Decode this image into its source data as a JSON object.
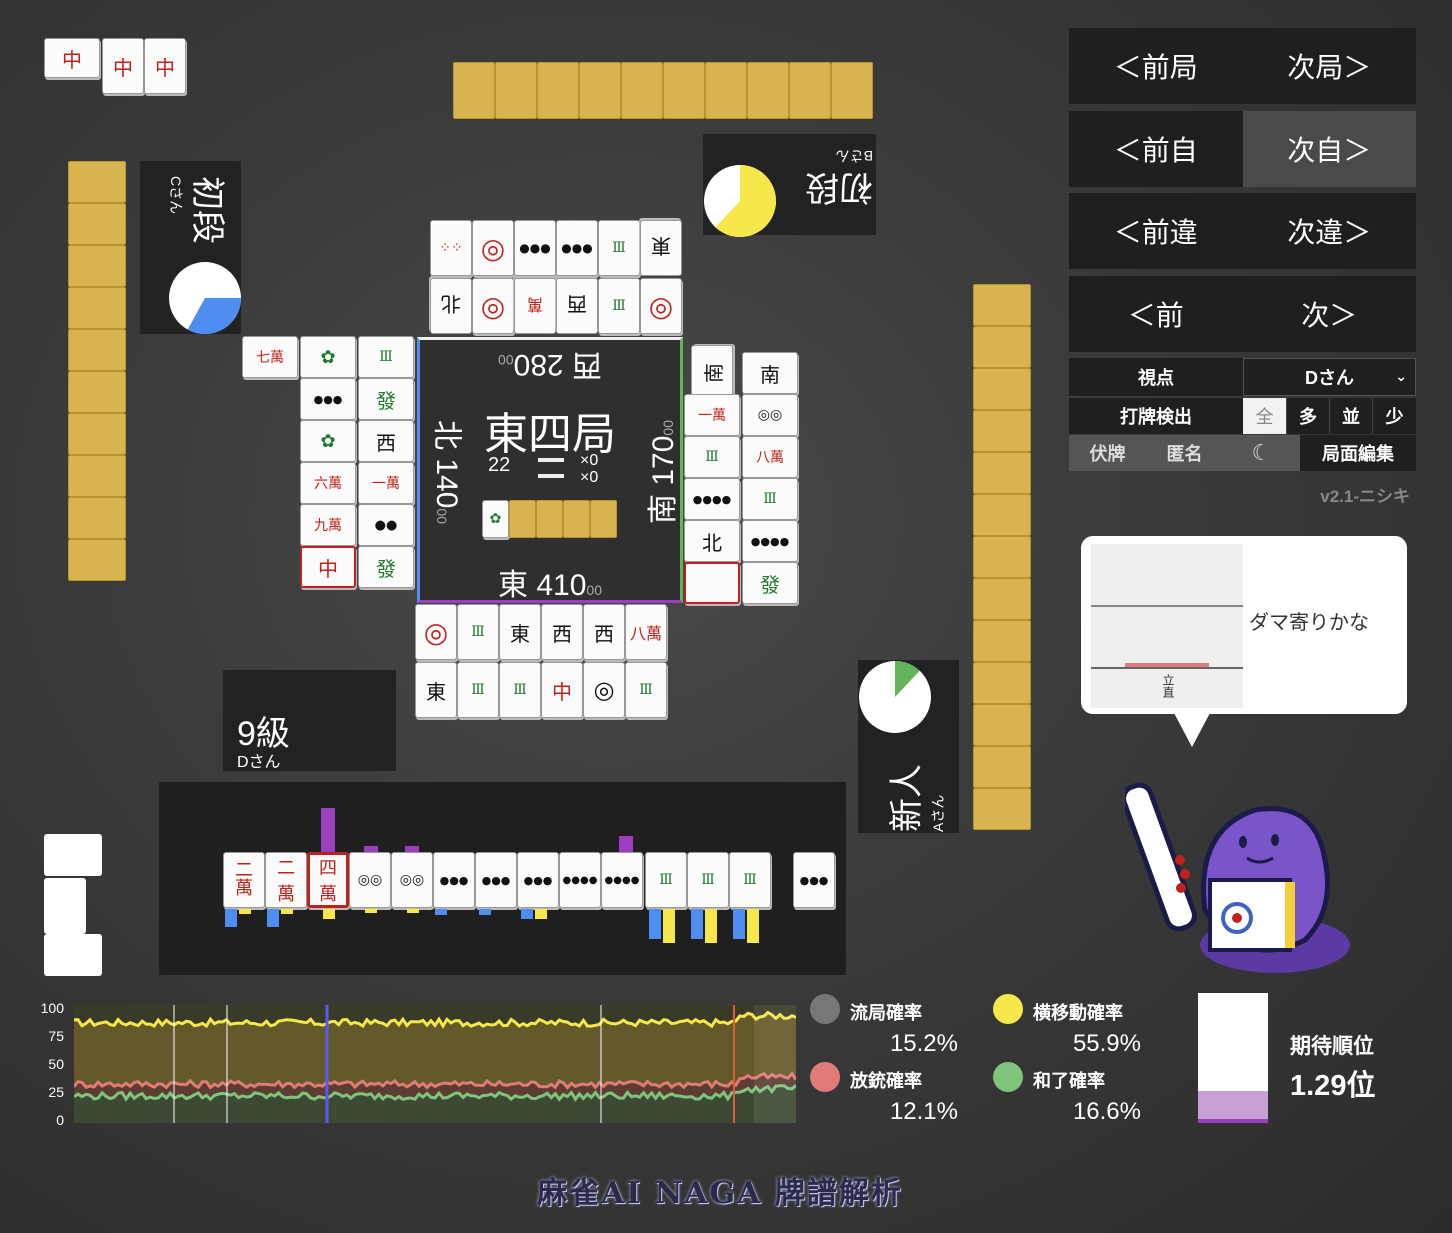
{
  "round": {
    "title": "東四局",
    "honba": "22",
    "riichi_sticks": "0",
    "honba_sticks": "0",
    "score_east": "東 410",
    "score_east_sub": "00",
    "score_south": "南 170",
    "score_south_sub": "00",
    "score_west": "西 280",
    "score_west_sub": "00",
    "score_north": "北 140",
    "score_north_sub": "00"
  },
  "players": {
    "top": {
      "rank": "初段",
      "name": "Bさん",
      "pie_fraction": 0.62,
      "pie_color": "#f6e84a"
    },
    "left": {
      "rank": "初段",
      "name": "Cさん",
      "pie_fraction": 0.33,
      "pie_color": "#4d8ef0"
    },
    "bottom": {
      "rank": "9級",
      "name": "Dさん"
    },
    "right": {
      "rank": "新人",
      "name": "Aさん",
      "pie_fraction": 0.12,
      "pie_color": "#62b35a"
    }
  },
  "nav": {
    "prev_round": "＜前局",
    "next_round": "次局＞",
    "prev_self": "＜前自",
    "next_self": "次自＞",
    "prev_diff": "＜前違",
    "next_diff": "次違＞",
    "prev": "＜前",
    "next": "次＞"
  },
  "settings": {
    "viewpoint_label": "視点",
    "viewpoint_value": "Dさん",
    "detect_label": "打牌検出",
    "detect_options": [
      "全",
      "多",
      "並",
      "少"
    ],
    "hide_tiles": "伏牌",
    "anonymous": "匿名",
    "moon_icon": "moon-icon",
    "edit": "局面編集",
    "version": "v2.1-ニシキ"
  },
  "bubble": {
    "text": "ダマ寄りかな",
    "axis_label": "立直"
  },
  "stats": {
    "draw_label": "流局確率",
    "draw_value": "15.2%",
    "draw_color": "#777777",
    "move_label": "横移動確率",
    "move_value": "55.9%",
    "move_color": "#f6e84a",
    "dealin_label": "放銃確率",
    "dealin_value": "12.1%",
    "dealin_color": "#e07b78",
    "win_label": "和了確率",
    "win_value": "16.6%",
    "win_color": "#7fc57a",
    "rank_label": "期待順位",
    "rank_value": "1.29位"
  },
  "chart_data": {
    "type": "line",
    "ylim": [
      0,
      100
    ],
    "yticks": [
      "100",
      "75",
      "50",
      "25",
      "0"
    ],
    "series": [
      {
        "color": "#f6e84a",
        "level": 85
      },
      {
        "color": "#e07b78",
        "level": 33
      },
      {
        "color": "#7fc57a",
        "level": 23
      }
    ]
  },
  "logo": "麻雀AI NAGA 牌譜解析"
}
